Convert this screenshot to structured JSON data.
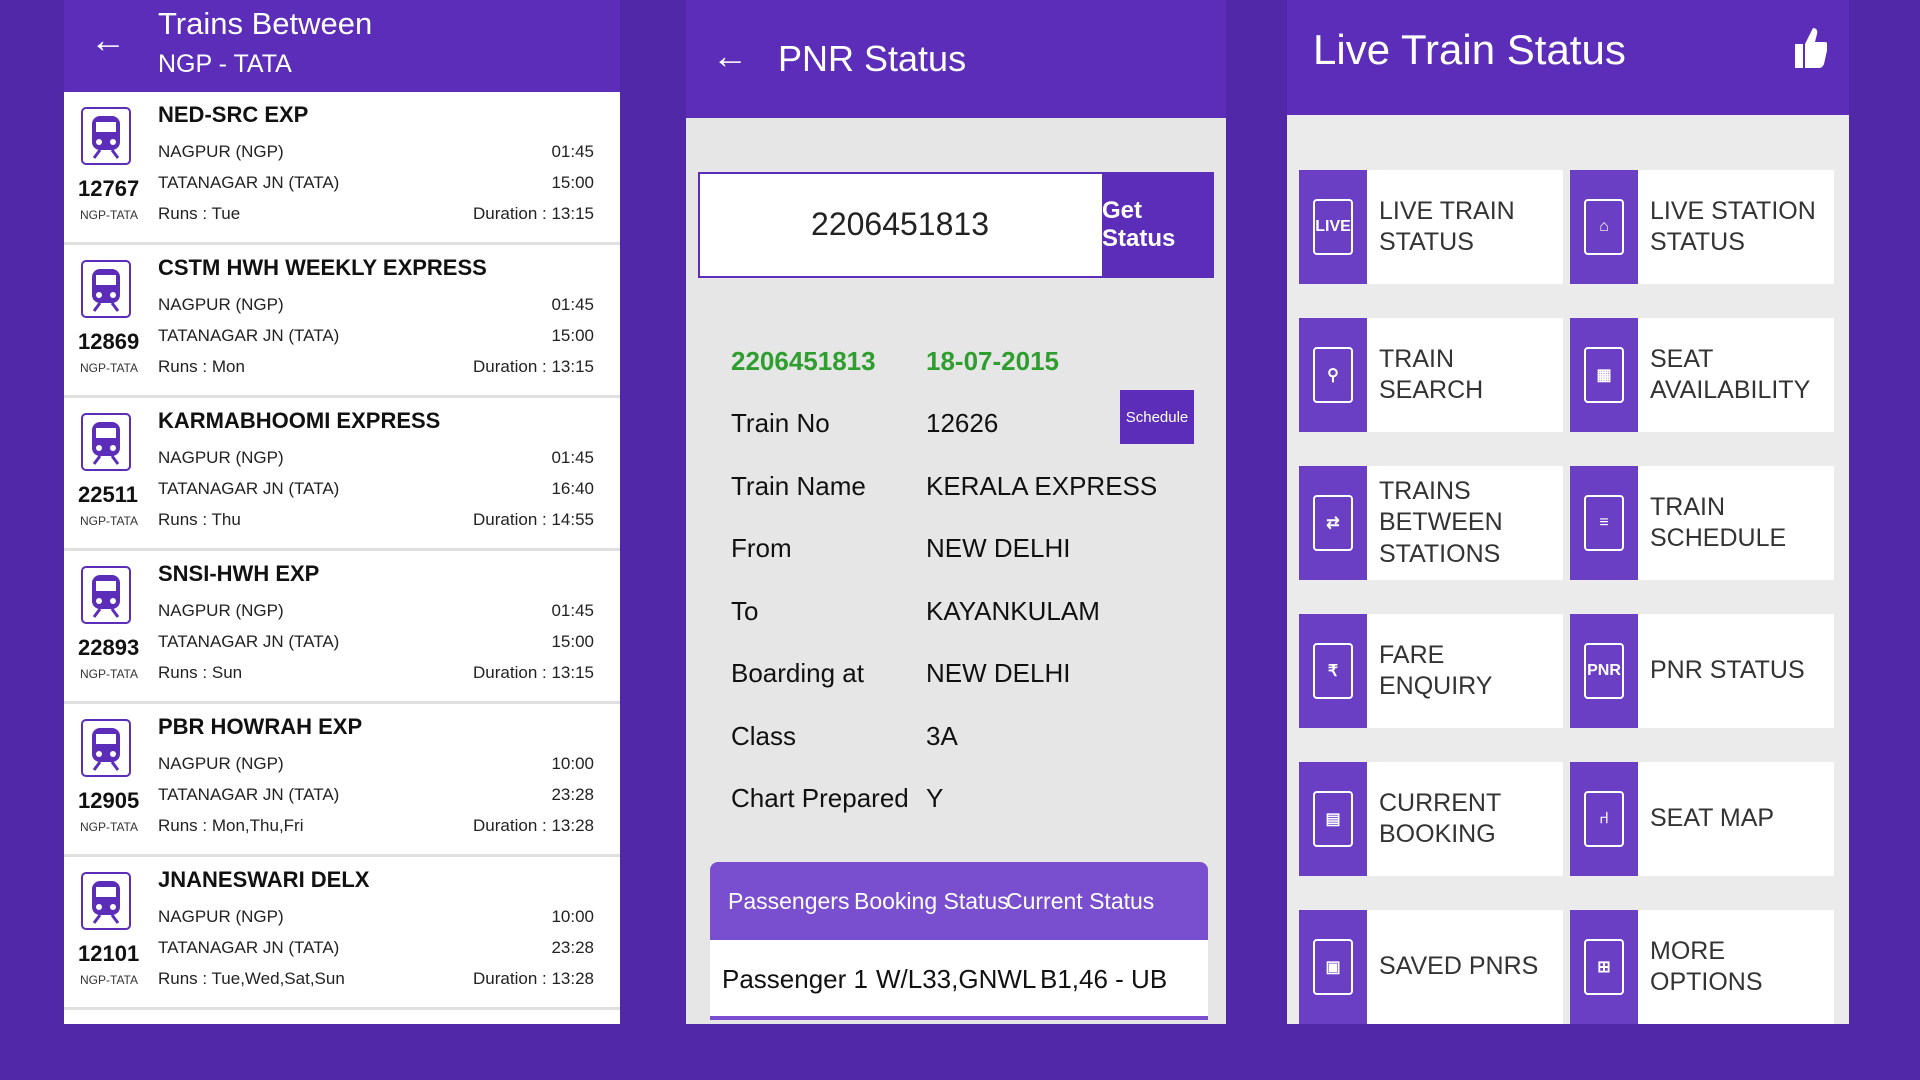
{
  "screen1": {
    "title": "Trains Between",
    "subtitle": "NGP - TATA",
    "trains": [
      {
        "number": "12767",
        "code": "NGP-TATA",
        "name": "NED-SRC EXP",
        "from": "NAGPUR (NGP)",
        "dep": "01:45",
        "to": "TATANAGAR JN (TATA)",
        "arr": "15:00",
        "runs": "Runs : Tue",
        "duration": "Duration : 13:15"
      },
      {
        "number": "12869",
        "code": "NGP-TATA",
        "name": "CSTM HWH WEEKLY EXPRESS",
        "from": "NAGPUR (NGP)",
        "dep": "01:45",
        "to": "TATANAGAR JN (TATA)",
        "arr": "15:00",
        "runs": "Runs : Mon",
        "duration": "Duration : 13:15"
      },
      {
        "number": "22511",
        "code": "NGP-TATA",
        "name": "KARMABHOOMI EXPRESS",
        "from": "NAGPUR (NGP)",
        "dep": "01:45",
        "to": "TATANAGAR JN (TATA)",
        "arr": "16:40",
        "runs": "Runs : Thu",
        "duration": "Duration : 14:55"
      },
      {
        "number": "22893",
        "code": "NGP-TATA",
        "name": "SNSI-HWH EXP",
        "from": "NAGPUR (NGP)",
        "dep": "01:45",
        "to": "TATANAGAR JN (TATA)",
        "arr": "15:00",
        "runs": "Runs : Sun",
        "duration": "Duration : 13:15"
      },
      {
        "number": "12905",
        "code": "NGP-TATA",
        "name": "PBR HOWRAH EXP",
        "from": "NAGPUR (NGP)",
        "dep": "10:00",
        "to": "TATANAGAR JN (TATA)",
        "arr": "23:28",
        "runs": "Runs : Mon,Thu,Fri",
        "duration": "Duration : 13:28"
      },
      {
        "number": "12101",
        "code": "NGP-TATA",
        "name": "JNANESWARI DELX",
        "from": "NAGPUR (NGP)",
        "dep": "10:00",
        "to": "TATANAGAR JN (TATA)",
        "arr": "23:28",
        "runs": "Runs : Tue,Wed,Sat,Sun",
        "duration": "Duration : 13:28"
      }
    ]
  },
  "screen2": {
    "title": "PNR Status",
    "pnr_input": "2206451813",
    "get_status_label": "Get Status",
    "pnr_value": "2206451813",
    "date": "18-07-2015",
    "schedule_label": "Schedule",
    "fields": [
      {
        "label": "Train No",
        "value": "12626"
      },
      {
        "label": "Train Name",
        "value": "KERALA EXPRESS"
      },
      {
        "label": "From",
        "value": "NEW DELHI"
      },
      {
        "label": "To",
        "value": "KAYANKULAM"
      },
      {
        "label": "Boarding at",
        "value": "NEW DELHI"
      },
      {
        "label": "Class",
        "value": "3A"
      },
      {
        "label": "Chart Prepared",
        "value": "Y"
      }
    ],
    "table_headers": [
      "Passengers",
      "Booking Status",
      "Current Status"
    ],
    "passenger": {
      "name": "Passenger 1",
      "booking": "W/L33,GNWL",
      "current": "B1,46 - UB"
    }
  },
  "screen3": {
    "title": "Live Train Status",
    "tiles": [
      {
        "label": "LIVE TRAIN STATUS",
        "icon": "live-pin-icon",
        "glyph": "LIVE"
      },
      {
        "label": "LIVE STATION STATUS",
        "icon": "station-icon",
        "glyph": "⌂"
      },
      {
        "label": "TRAIN SEARCH",
        "icon": "search-icon",
        "glyph": "⚲"
      },
      {
        "label": "SEAT AVAILABILITY",
        "icon": "calendar-icon",
        "glyph": "▦"
      },
      {
        "label": "TRAINS BETWEEN STATIONS",
        "icon": "route-icon",
        "glyph": "⇄"
      },
      {
        "label": "TRAIN SCHEDULE",
        "icon": "document-icon",
        "glyph": "≡"
      },
      {
        "label": "FARE ENQUIRY",
        "icon": "rupee-icon",
        "glyph": "₹"
      },
      {
        "label": "PNR STATUS",
        "icon": "pnr-icon",
        "glyph": "PNR"
      },
      {
        "label": "CURRENT BOOKING",
        "icon": "booking-icon",
        "glyph": "▤"
      },
      {
        "label": "SEAT MAP",
        "icon": "seat-icon",
        "glyph": "⑁"
      },
      {
        "label": "SAVED PNRS",
        "icon": "save-icon",
        "glyph": "▣"
      },
      {
        "label": "MORE OPTIONS",
        "icon": "train-icon",
        "glyph": "⊞"
      }
    ]
  },
  "colors": {
    "background": "#5028a8",
    "appbar": "#5b2db8",
    "accent": "#7a4fcf",
    "green": "#2e9e2e"
  }
}
